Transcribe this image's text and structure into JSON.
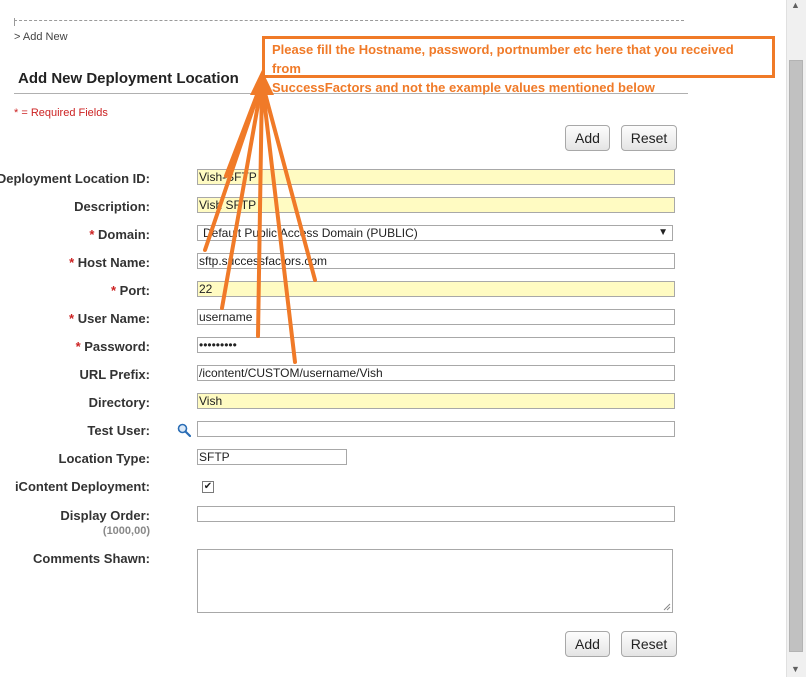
{
  "breadcrumb": "> Add New",
  "page_title": "Add New Deployment Location",
  "required_note": "* = Required Fields",
  "buttons": {
    "add": "Add",
    "reset": "Reset"
  },
  "required_marker": "*",
  "fields": {
    "location_id": {
      "label": "Deployment Location ID:",
      "value": "Vish-SFTP"
    },
    "description": {
      "label": "Description:",
      "value": "Vish SFTP"
    },
    "domain": {
      "label": "Domain:",
      "value": "Default Public Access Domain (PUBLIC)"
    },
    "host_name": {
      "label": "Host Name:",
      "value": "sftp.successfactors.com"
    },
    "port": {
      "label": "Port:",
      "value": "22"
    },
    "user_name": {
      "label": "User Name:",
      "value": "username"
    },
    "password": {
      "label": "Password:",
      "value": "password1"
    },
    "url_prefix": {
      "label": "URL Prefix:",
      "value": "/icontent/CUSTOM/username/Vish"
    },
    "directory": {
      "label": "Directory:",
      "value": "Vish"
    },
    "test_user": {
      "label": "Test User:",
      "value": ""
    },
    "location_type": {
      "label": "Location Type:",
      "value": "SFTP"
    },
    "icontent_deployment": {
      "label": "iContent Deployment:",
      "checked": true
    },
    "display_order": {
      "label": "Display Order:",
      "hint": "(1000,00)",
      "value": ""
    },
    "comments": {
      "label": "Comments Shawn:",
      "value": ""
    }
  },
  "annotation": {
    "line1": "Please fill the Hostname, password, portnumber etc here that you received from",
    "line2": "SuccessFactors and not the example values mentioned below",
    "color": "#f07a28"
  },
  "icons": {
    "test_user_lookup": "magnifier-icon",
    "dropdown": "triangle-down-icon",
    "checkbox": "checkmark-icon"
  }
}
